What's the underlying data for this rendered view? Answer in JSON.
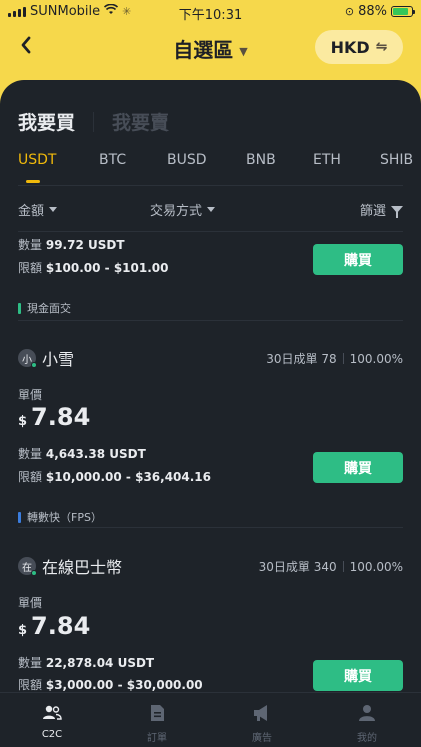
{
  "status_bar": {
    "carrier": "SUNMobile",
    "time": "下午10:31",
    "battery": "88%"
  },
  "header": {
    "back_icon": "chevron-left-icon",
    "title": "自選區",
    "title_caret": "▼",
    "currency": "HKD",
    "swap_icon": "⇋"
  },
  "mode_tabs": [
    {
      "label": "我要買",
      "active": true
    },
    {
      "label": "我要賣",
      "active": false
    }
  ],
  "coin_tabs": [
    {
      "label": "USDT",
      "active": true
    },
    {
      "label": "BTC",
      "active": false
    },
    {
      "label": "BUSD",
      "active": false
    },
    {
      "label": "BNB",
      "active": false
    },
    {
      "label": "ETH",
      "active": false
    },
    {
      "label": "SHIB",
      "active": false
    }
  ],
  "filters": {
    "amount": "金額",
    "payment": "交易方式",
    "filter": "篩選"
  },
  "listing_partial": {
    "quantity_label": "數量",
    "quantity": "99.72 USDT",
    "limit_label": "限額",
    "limit": "$100.00 - $101.00",
    "buy_label": "購買",
    "payment_method": "現金面交",
    "payment_color": "#2ebd85"
  },
  "listings": [
    {
      "avatar_char": "小",
      "name": "小雪",
      "orders_label": "30日成單",
      "orders": "78",
      "completion": "100.00%",
      "price_label": "單價",
      "currency_symbol": "$",
      "price": "7.84",
      "quantity_label": "數量",
      "quantity": "4,643.38 USDT",
      "limit_label": "限額",
      "limit": "$10,000.00 - $36,404.16",
      "buy_label": "購買",
      "payment_method": "轉數快（FPS）",
      "payment_color": "#3b7ddd"
    },
    {
      "avatar_char": "在",
      "name": "在線巴士幣",
      "orders_label": "30日成單",
      "orders": "340",
      "completion": "100.00%",
      "price_label": "單價",
      "currency_symbol": "$",
      "price": "7.84",
      "quantity_label": "數量",
      "quantity": "22,878.04 USDT",
      "limit_label": "限額",
      "limit": "$3,000.00 - $30,000.00",
      "buy_label": "購買"
    }
  ],
  "bottom_nav": [
    {
      "label": "C2C",
      "icon": "users-icon",
      "active": true
    },
    {
      "label": "訂單",
      "icon": "document-icon",
      "active": false
    },
    {
      "label": "廣告",
      "icon": "megaphone-icon",
      "active": false
    },
    {
      "label": "我的",
      "icon": "profile-icon",
      "active": false
    }
  ]
}
